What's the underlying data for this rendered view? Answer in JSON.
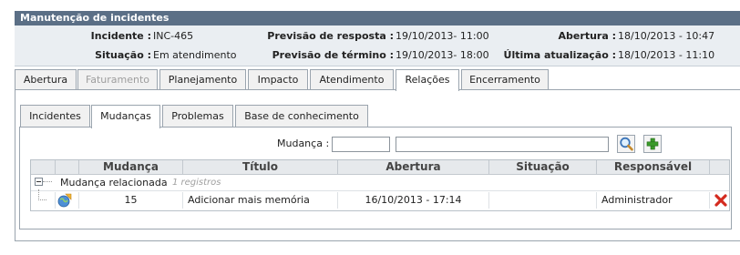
{
  "window": {
    "title": "Manutenção de incidentes"
  },
  "info": {
    "incidente_label": "Incidente :",
    "incidente_value": "INC-465",
    "situacao_label": "Situação :",
    "situacao_value": "Em atendimento",
    "previsao_resposta_label": "Previsão de resposta :",
    "previsao_resposta_value": "19/10/2013- 11:00",
    "previsao_termino_label": "Previsão de término :",
    "previsao_termino_value": "19/10/2013- 18:00",
    "abertura_label": "Abertura :",
    "abertura_value": "18/10/2013 - 10:47",
    "ultima_atualizacao_label": "Última atualização :",
    "ultima_atualizacao_value": "18/10/2013 - 11:10"
  },
  "tabs": {
    "abertura": "Abertura",
    "faturamento": "Faturamento",
    "planejamento": "Planejamento",
    "impacto": "Impacto",
    "atendimento": "Atendimento",
    "relacoes": "Relações",
    "encerramento": "Encerramento",
    "active": "Relações",
    "disabled": "Faturamento"
  },
  "subtabs": {
    "incidentes": "Incidentes",
    "mudancas": "Mudanças",
    "problemas": "Problemas",
    "base_conhecimento": "Base de conhecimento",
    "active": "Mudanças"
  },
  "search": {
    "label": "Mudança :",
    "code_value": "",
    "title_value": "",
    "search_icon": "magnifier-icon",
    "add_icon": "plus-icon"
  },
  "grid": {
    "headers": {
      "mudanca": "Mudança",
      "titulo": "Título",
      "abertura": "Abertura",
      "situacao": "Situação",
      "responsavel": "Responsável"
    },
    "group": {
      "label": "Mudança relacionada",
      "count": "1 registros"
    },
    "rows": [
      {
        "mudanca": "15",
        "titulo": "Adicionar mais memória",
        "abertura": "16/10/2013 - 17:14",
        "situacao": "",
        "responsavel": "Administrador",
        "row_icon": "change-globe-icon",
        "delete_icon": "delete-x-icon"
      }
    ]
  },
  "colors": {
    "title_bar": "#5b6f86",
    "info_bg": "#eaeef2",
    "delete": "#d42a1e",
    "add": "#3a9a2a"
  }
}
